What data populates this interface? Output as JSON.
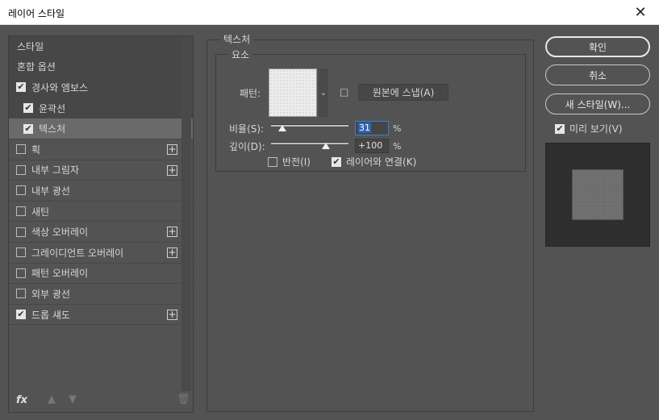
{
  "window": {
    "title": "레이어 스타일",
    "close_glyph": "✕"
  },
  "sidebar": {
    "items": [
      {
        "label": "스타일",
        "checkbox": false,
        "checked": false,
        "plus": false,
        "indent": false,
        "selected": false
      },
      {
        "label": "혼합 옵션",
        "checkbox": false,
        "checked": false,
        "plus": false,
        "indent": false,
        "selected": false
      },
      {
        "label": "경사와 엠보스",
        "checkbox": true,
        "checked": true,
        "plus": false,
        "indent": false,
        "selected": false
      },
      {
        "label": "윤곽선",
        "checkbox": true,
        "checked": true,
        "plus": false,
        "indent": true,
        "selected": false
      },
      {
        "label": "텍스처",
        "checkbox": true,
        "checked": true,
        "plus": false,
        "indent": true,
        "selected": true
      },
      {
        "label": "획",
        "checkbox": true,
        "checked": false,
        "plus": true,
        "indent": false,
        "selected": false
      },
      {
        "label": "내부 그림자",
        "checkbox": true,
        "checked": false,
        "plus": true,
        "indent": false,
        "selected": false
      },
      {
        "label": "내부 광선",
        "checkbox": true,
        "checked": false,
        "plus": false,
        "indent": false,
        "selected": false
      },
      {
        "label": "새틴",
        "checkbox": true,
        "checked": false,
        "plus": false,
        "indent": false,
        "selected": false
      },
      {
        "label": "색상 오버레이",
        "checkbox": true,
        "checked": false,
        "plus": true,
        "indent": false,
        "selected": false
      },
      {
        "label": "그레이디언트 오버레이",
        "checkbox": true,
        "checked": false,
        "plus": true,
        "indent": false,
        "selected": false
      },
      {
        "label": "패턴 오버레이",
        "checkbox": true,
        "checked": false,
        "plus": false,
        "indent": false,
        "selected": false
      },
      {
        "label": "외부 광선",
        "checkbox": true,
        "checked": false,
        "plus": false,
        "indent": false,
        "selected": false
      },
      {
        "label": "드롭 섀도",
        "checkbox": true,
        "checked": true,
        "plus": true,
        "indent": false,
        "selected": false
      }
    ],
    "fx_label": "fx",
    "move_up_icon": "▲",
    "move_down_icon": "▼",
    "trash_icon": "🗑"
  },
  "texture": {
    "group_title": "텍스처",
    "subgroup_title": "요소",
    "pattern_label": "패턴:",
    "snap_button": "원본에 스냅(A)",
    "scale_label": "비율(S):",
    "scale_value": "31",
    "depth_label": "깊이(D):",
    "depth_value": "+100",
    "percent": "%",
    "invert_label": "반전(I)",
    "invert_checked": false,
    "link_label": "레이어와 연결(K)",
    "link_checked": true,
    "scale_fraction": 0.15,
    "depth_fraction": 0.71
  },
  "actions": {
    "ok": "확인",
    "cancel": "취소",
    "new_style": "새 스타일(W)...",
    "preview_label": "미리 보기(V)",
    "preview_checked": true
  }
}
